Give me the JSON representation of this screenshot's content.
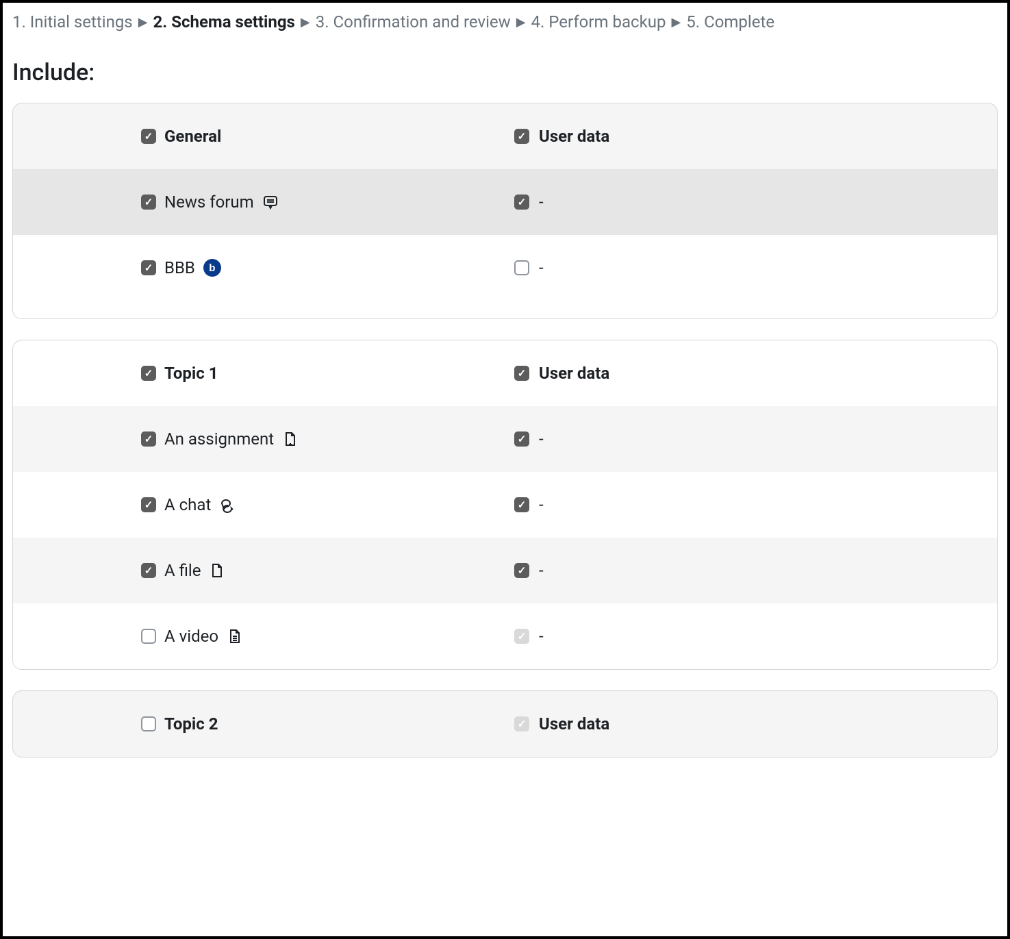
{
  "breadcrumb": {
    "step1": "1. Initial settings",
    "step2": "2. Schema settings",
    "step3": "3. Confirmation and review",
    "step4": "4. Perform backup",
    "step5": "5. Complete"
  },
  "heading": "Include:",
  "userDataLabel": "User data",
  "dash": "-",
  "sections": {
    "general": {
      "title": "General",
      "items": {
        "newsforum": "News forum",
        "bbb": "BBB"
      }
    },
    "topic1": {
      "title": "Topic 1",
      "items": {
        "assignment": "An assignment",
        "chat": "A chat",
        "file": "A file",
        "video": "A video"
      }
    },
    "topic2": {
      "title": "Topic 2"
    }
  },
  "bbbIconLetter": "b"
}
